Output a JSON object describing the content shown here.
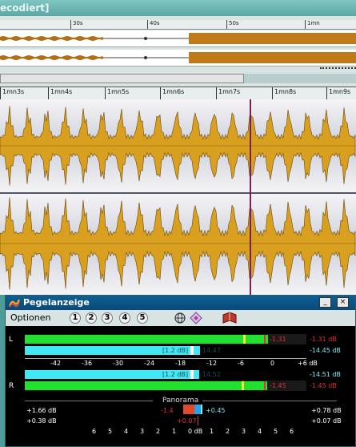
{
  "window_title_fragment": "ecodiert]",
  "overview_ruler": [
    "30s",
    "40s",
    "50s",
    "1mn"
  ],
  "main_ruler": [
    "1mn3s",
    "1mn4s",
    "1mn5s",
    "1mn6s",
    "1mn7s",
    "1mn8s",
    "1mn9s"
  ],
  "meter": {
    "title": "Pegelanzeige",
    "menu_options": "Optionen",
    "presets": [
      "1",
      "2",
      "3",
      "4",
      "5"
    ],
    "minimize_label": "_",
    "close_label": "×",
    "channel_left": "L",
    "channel_right": "R",
    "scale": [
      "-42",
      "-36",
      "-30",
      "-24",
      "-18",
      "-12",
      "-6",
      "0",
      "+6 dB"
    ],
    "left_peak_hold": "-1.31",
    "left_peak_db": "-1.31 dB",
    "left_rms_box": "[1.2 dB]",
    "left_rms": "-14.47",
    "left_rms_db": "-14.45 dB",
    "right_rms_box": "[1.2 dB]",
    "right_rms": "-14.52",
    "right_rms_db": "-14.51 dB",
    "right_peak_hold": "-1.45",
    "right_peak_db": "-1.45 dB",
    "left_peak_level_db": -1.31,
    "left_rms_level_db": -14.47,
    "right_rms_level_db": -14.52,
    "right_peak_level_db": -1.45,
    "panorama_label": "Panorama",
    "pan_left_top": "+1.66 dB",
    "pan_left_bottom": "+0.38 dB",
    "pan_right_top": "+0.78 dB",
    "pan_right_bottom": "+0.07 dB",
    "pan_marker_left": "-1.4",
    "pan_marker_right": "+0.45",
    "pan_marker_bottom": "+0.07",
    "pan_scale": [
      "6",
      "5",
      "4",
      "3",
      "2",
      "1",
      "0 dB",
      "1",
      "2",
      "3",
      "4",
      "5",
      "6"
    ]
  },
  "colors": {
    "waveform": "#d9a020",
    "peak_bar": "#22e030",
    "rms_bar": "#40e8f4",
    "cursor": "#7a1f5a"
  }
}
